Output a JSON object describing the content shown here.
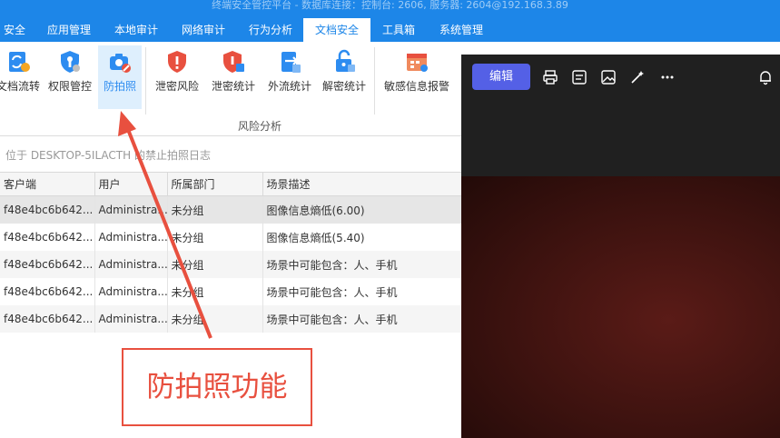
{
  "window": {
    "title": "终端安全管控平台 - 数据库连接：控制台: 2606, 服务器: 2604@192.168.3.89"
  },
  "menu": [
    {
      "label": "安全",
      "active": false
    },
    {
      "label": "应用管理",
      "active": false
    },
    {
      "label": "本地审计",
      "active": false
    },
    {
      "label": "网络审计",
      "active": false
    },
    {
      "label": "行为分析",
      "active": false
    },
    {
      "label": "文档安全",
      "active": true
    },
    {
      "label": "工具箱",
      "active": false
    },
    {
      "label": "系统管理",
      "active": false
    }
  ],
  "ribbon": {
    "buttons": [
      {
        "label": "文档流转",
        "icon": "document-flow-icon"
      },
      {
        "label": "权限管控",
        "icon": "permission-shield-icon"
      },
      {
        "label": "防拍照",
        "icon": "camera-block-icon",
        "selected": true
      },
      {
        "label": "泄密风险",
        "icon": "leak-risk-shield-icon"
      },
      {
        "label": "泄密统计",
        "icon": "leak-stats-shield-icon"
      },
      {
        "label": "外流统计",
        "icon": "outflow-stats-icon"
      },
      {
        "label": "解密统计",
        "icon": "decrypt-stats-icon"
      },
      {
        "label": "敏感信息报警",
        "icon": "sensitive-alarm-icon"
      }
    ],
    "group_label": "风险分析"
  },
  "path_text": "位于 DESKTOP-5ILACTH 的禁止拍照日志",
  "table": {
    "columns": [
      "客户端",
      "用户",
      "所属部门",
      "场景描述"
    ],
    "rows": [
      [
        "f48e4bc6b642...",
        "Administra...",
        "未分组",
        "图像信息熵低(6.00)"
      ],
      [
        "f48e4bc6b642...",
        "Administra...",
        "未分组",
        "图像信息熵低(5.40)"
      ],
      [
        "f48e4bc6b642...",
        "Administra...",
        "未分组",
        "场景中可能包含：人、手机"
      ],
      [
        "f48e4bc6b642...",
        "Administra...",
        "未分组",
        "场景中可能包含：人、手机"
      ],
      [
        "f48e4bc6b642...",
        "Administra...",
        "未分组",
        "场景中可能包含：人、手机"
      ]
    ]
  },
  "viewer": {
    "edit_label": "编辑",
    "toolbar_icons": [
      "print-icon",
      "details-icon",
      "image-edit-icon",
      "magic-pen-icon",
      "more-icon",
      "notification-bell-icon"
    ]
  },
  "annotation": {
    "callout_text": "防拍照功能",
    "color": "#e8503f"
  },
  "colors": {
    "menubar": "#1d86e8",
    "edit_button": "#5460e6",
    "selected": "#deeffd"
  }
}
